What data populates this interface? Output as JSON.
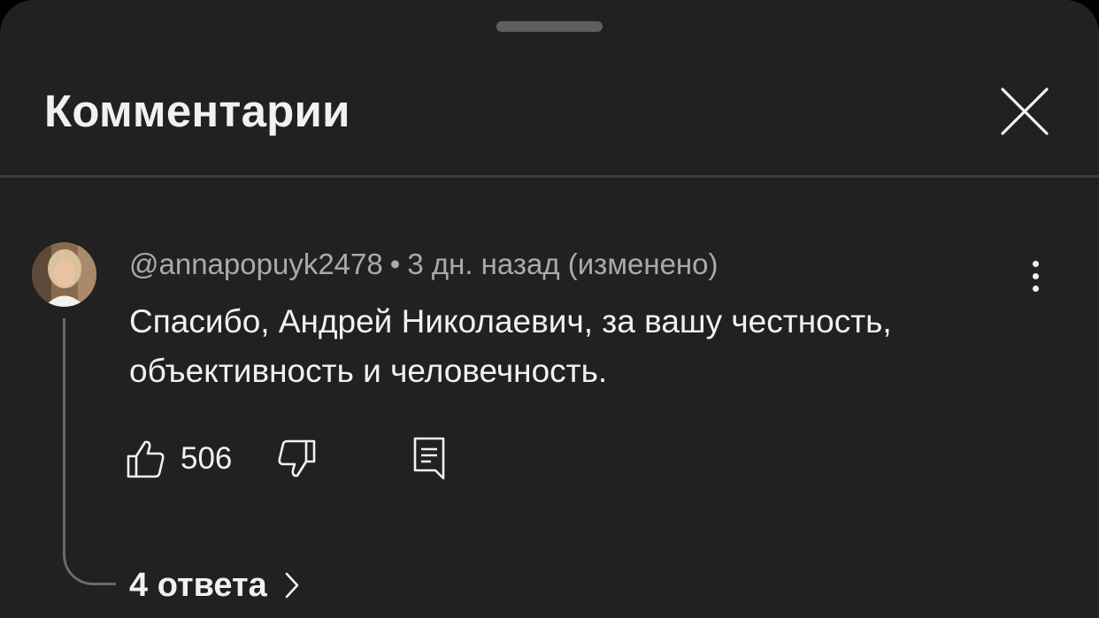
{
  "sheet": {
    "title": "Комментарии"
  },
  "comment": {
    "author": "@annapopuyk2478",
    "separator": "•",
    "time": "3 дн. назад (изменено)",
    "text": "Спасибо, Андрей Николаевич, за вашу честность, объективность и человечность.",
    "likes": "506",
    "replies_label": "4 ответа"
  },
  "icons": {
    "close": "close-icon",
    "more": "more-vert-icon",
    "like": "thumb-up-icon",
    "dislike": "thumb-down-icon",
    "reply": "reply-comment-icon",
    "chevron": "chevron-right-icon"
  },
  "colors": {
    "background": "#212121",
    "text_primary": "#f1f1f1",
    "text_secondary": "#aaaaaa",
    "divider": "#3d3d3d"
  }
}
